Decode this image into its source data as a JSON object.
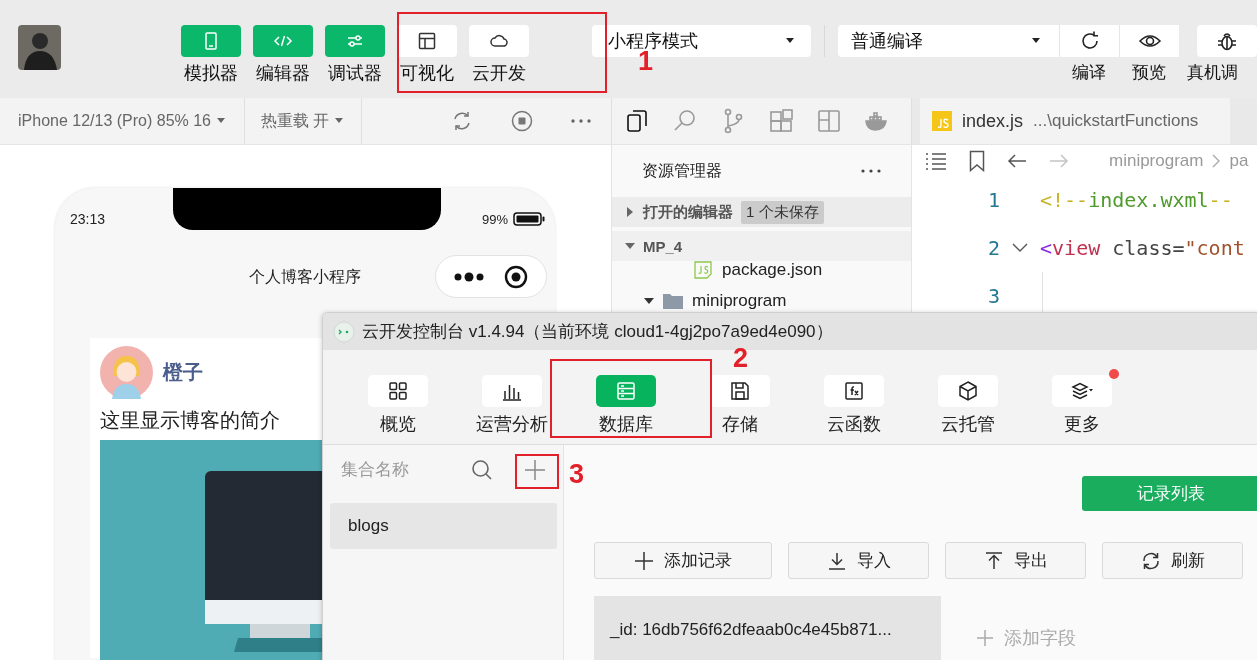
{
  "toolbar": {
    "view_buttons": [
      {
        "label": "模拟器",
        "on": true
      },
      {
        "label": "编辑器",
        "on": true
      },
      {
        "label": "调试器",
        "on": true
      },
      {
        "label": "可视化",
        "on": false
      },
      {
        "label": "云开发",
        "on": false
      }
    ],
    "mode_select": "小程序模式",
    "compile_select": "普通编译",
    "actions": [
      {
        "label": "编译"
      },
      {
        "label": "预览"
      },
      {
        "label": "真机调"
      }
    ]
  },
  "simulator": {
    "device": "iPhone 12/13 (Pro) 85% 16",
    "hot_reload": "热重载 开",
    "time": "23:13",
    "battery": "99%",
    "page_title": "个人博客小程序",
    "author": "橙子",
    "intro": "这里显示博客的简介"
  },
  "explorer": {
    "activity_bar": [
      {
        "selected": true
      },
      {
        "selected": false
      },
      {
        "selected": false
      },
      {
        "selected": false
      },
      {
        "selected": false
      },
      {
        "selected": false
      }
    ],
    "title": "资源管理器",
    "open_editors": {
      "label": "打开的编辑器",
      "badge": "1 个未保存",
      "expanded": false
    },
    "project": {
      "label": "MP_4",
      "expanded": true
    },
    "files": [
      {
        "name": "package.json",
        "kind": "file"
      },
      {
        "name": "miniprogram",
        "kind": "folder",
        "expanded": true
      }
    ]
  },
  "editor": {
    "tab": {
      "name": "index.js",
      "path": "...\\quickstartFunctions"
    },
    "breadcrumb": [
      "miniprogram",
      "pa"
    ],
    "lines": [
      {
        "number": "1",
        "foldable": false,
        "tokens": [
          {
            "kind": "comment_mark",
            "text": "<!--"
          },
          {
            "kind": "comment",
            "text": "index.wxml"
          },
          {
            "kind": "comment_mark",
            "text": "--"
          }
        ]
      },
      {
        "number": "2",
        "foldable": true,
        "tokens": [
          {
            "kind": "bracket",
            "text": "<"
          },
          {
            "kind": "tag",
            "text": "view"
          },
          {
            "kind": "attr",
            "text": " class="
          },
          {
            "kind": "string",
            "text": "\"cont"
          }
        ]
      },
      {
        "number": "3",
        "foldable": false
      }
    ]
  },
  "console": {
    "title": "云开发控制台 v1.4.94（当前环境 cloud1-4gj2po7a9ed4e090）",
    "tabs": [
      {
        "label": "概览",
        "selected": false,
        "notification": false
      },
      {
        "label": "运营分析",
        "selected": false,
        "notification": false
      },
      {
        "label": "数据库",
        "selected": true,
        "notification": false
      },
      {
        "label": "存储",
        "selected": false,
        "notification": false
      },
      {
        "label": "云函数",
        "selected": false,
        "notification": false
      },
      {
        "label": "云托管",
        "selected": false,
        "notification": false
      },
      {
        "label": "更多",
        "selected": false,
        "notification": true
      }
    ],
    "search_placeholder": "集合名称",
    "collections": [
      {
        "name": "blogs",
        "selected": true
      }
    ],
    "view_button": "记录列表",
    "actions": [
      "添加记录",
      "导入",
      "导出",
      "刷新"
    ],
    "records": [
      {
        "id": "_id: 16db756f62dfeaab0c4e45b871...",
        "selected": true
      }
    ],
    "add_field": "添加字段"
  },
  "annotations": [
    {
      "label": "1"
    },
    {
      "label": "2"
    },
    {
      "label": "3"
    }
  ]
}
